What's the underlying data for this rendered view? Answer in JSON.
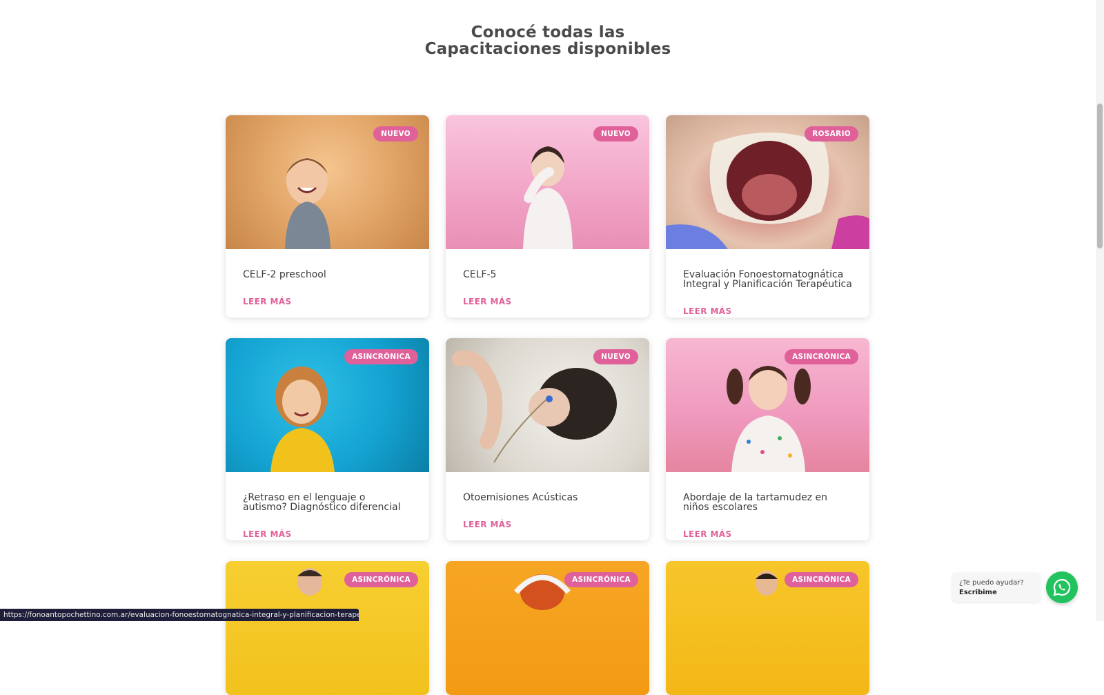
{
  "heading": {
    "line1": "Conocé todas las",
    "line2": "Capacitaciones disponibles"
  },
  "cards": [
    {
      "title": "CELF-2 preschool",
      "badge": "NUEVO",
      "link": "LEER MÁS",
      "image_icon": "child-laughing-photo"
    },
    {
      "title": "CELF-5",
      "badge": "NUEVO",
      "link": "LEER MÁS",
      "image_icon": "girl-covering-nose-photo"
    },
    {
      "title": "Evaluación Fonoestomatognática Integral y Planificación Terapéutica",
      "badge": "ROSARIO",
      "link": "LEER MÁS",
      "image_icon": "open-mouth-photo"
    },
    {
      "title": "¿Retraso en el lenguaje o autismo? Diagnóstico diferencial",
      "badge": "ASINCRÓNICA",
      "link": "LEER MÁS",
      "image_icon": "curly-haired-child-photo"
    },
    {
      "title": "Otoemisiones Acústicas",
      "badge": "NUEVO",
      "link": "LEER MÁS",
      "image_icon": "newborn-hearing-test-photo"
    },
    {
      "title": "Abordaje de la tartamudez en niños escolares",
      "badge": "ASINCRÓNICA",
      "link": "LEER MÁS",
      "image_icon": "girl-pigtails-photo"
    },
    {
      "title": "",
      "badge": "ASINCRÓNICA",
      "link": "",
      "image_icon": "boy-yellow-background-photo"
    },
    {
      "title": "",
      "badge": "ASINCRÓNICA",
      "link": "",
      "image_icon": "child-headphones-photo"
    },
    {
      "title": "",
      "badge": "ASINCRÓNICA",
      "link": "",
      "image_icon": "boy-yellow-background-photo"
    }
  ],
  "status_bar": {
    "url": "https://fonoantopochettino.com.ar/evaluacion-fonoestomatognatica-integral-y-planificacion-terapeutica/"
  },
  "chat": {
    "question": "¿Te puedo ayudar?",
    "action": "Escribime",
    "icon": "whatsapp-icon"
  },
  "colors": {
    "accent": "#e0619a",
    "whatsapp": "#22c35e",
    "heading": "#4a4a4a"
  }
}
